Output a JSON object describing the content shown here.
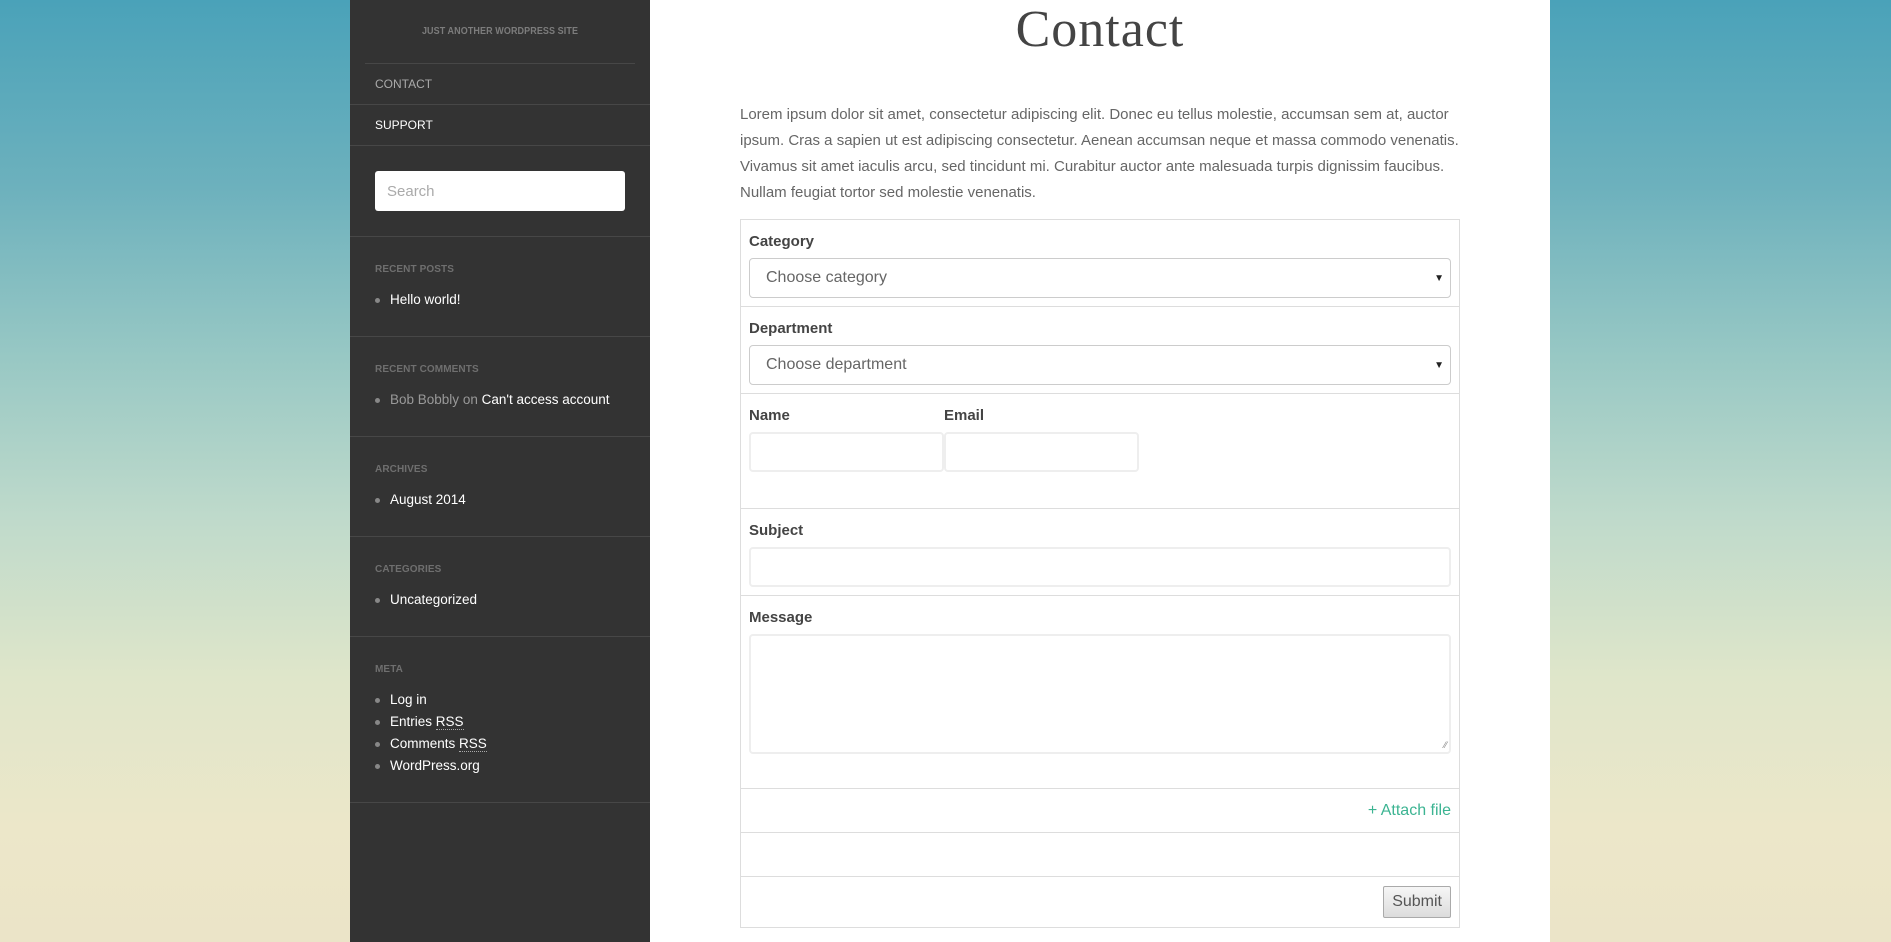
{
  "sidebar": {
    "site_description": "JUST ANOTHER WORDPRESS SITE",
    "menu": [
      {
        "label": "CONTACT"
      },
      {
        "label": "SUPPORT"
      }
    ],
    "search": {
      "placeholder": "Search",
      "value": ""
    },
    "widgets": {
      "recent_posts": {
        "title": "RECENT POSTS",
        "items": [
          "Hello world!"
        ]
      },
      "recent_comments": {
        "title": "RECENT COMMENTS",
        "items": [
          {
            "author": "Bob Bobbly",
            "connector": "on",
            "post": "Can't access account"
          }
        ]
      },
      "archives": {
        "title": "ARCHIVES",
        "items": [
          "August 2014"
        ]
      },
      "categories": {
        "title": "CATEGORIES",
        "items": [
          "Uncategorized"
        ]
      },
      "meta": {
        "title": "META",
        "items": [
          {
            "label": "Log in"
          },
          {
            "label": "Entries",
            "abbr": "RSS"
          },
          {
            "label": "Comments",
            "abbr": "RSS"
          },
          {
            "label": "WordPress.org"
          }
        ]
      }
    }
  },
  "main": {
    "title": "Contact",
    "intro": "Lorem ipsum dolor sit amet, consectetur adipiscing elit. Donec eu tellus molestie, accumsan sem at, auctor ipsum. Cras a sapien ut est adipiscing consectetur. Aenean accumsan neque et massa commodo venenatis. Vivamus sit amet iaculis arcu, sed tincidunt mi. Curabitur auctor ante malesuada turpis dignissim faucibus. Nullam feugiat tortor sed molestie venenatis.",
    "form": {
      "category": {
        "label": "Category",
        "selected": "Choose category"
      },
      "department": {
        "label": "Department",
        "selected": "Choose department"
      },
      "name": {
        "label": "Name",
        "value": ""
      },
      "email": {
        "label": "Email",
        "value": ""
      },
      "subject": {
        "label": "Subject",
        "value": ""
      },
      "message": {
        "label": "Message",
        "value": ""
      },
      "attach_label": "+ Attach file",
      "submit_label": "Submit"
    }
  },
  "colors": {
    "sidebar_bg": "#333333",
    "accent_link": "#3cb492",
    "bg_top": "#4aa2b9",
    "bg_bottom": "#ebe4c8"
  }
}
